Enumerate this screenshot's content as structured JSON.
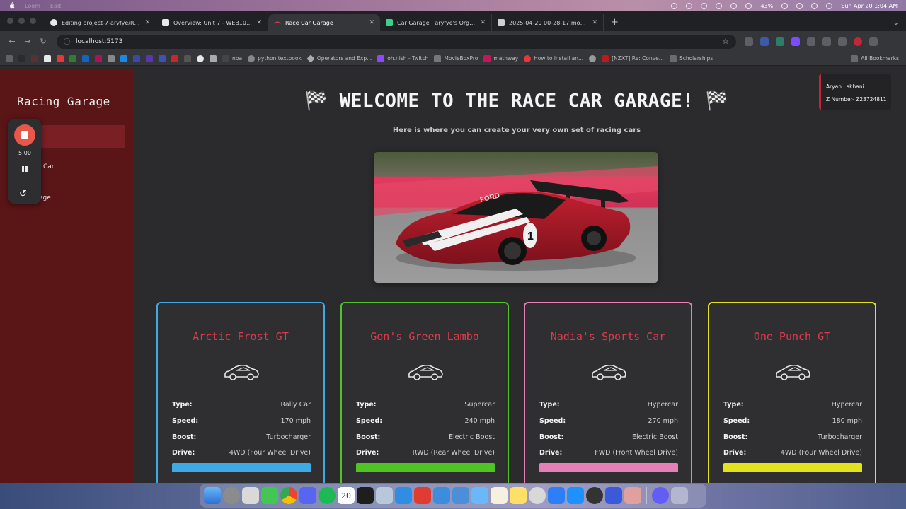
{
  "menubar": {
    "menus": [
      "Loom",
      "Edit"
    ],
    "battery": "43%",
    "datetime": "Sun Apr 20  1:04 AM"
  },
  "browser": {
    "tabs": [
      {
        "title": "Editing project-7-aryfye/README",
        "favicon_color": "#e8e8e8",
        "favicon": "github-icon"
      },
      {
        "title": "Overview: Unit 7 - WEB102 | C...",
        "favicon_color": "#e8e8e8",
        "favicon": "codepath-icon"
      },
      {
        "title": "Race Car Garage",
        "favicon_color": "#e23a4d",
        "favicon": "react-icon"
      },
      {
        "title": "Car Garage | aryfye's Org | Su...",
        "favicon_color": "#3ecf8e",
        "favicon": "supabase-icon"
      },
      {
        "title": "2025-04-20 00-28-17.mov - ...",
        "favicon_color": "#cfcfcf",
        "favicon": "drive-icon"
      }
    ],
    "active_tab_index": 2,
    "url": "localhost:5173",
    "bookmarks": [
      {
        "label": "nba",
        "color": "#444"
      },
      {
        "label": "python textbook",
        "color": "#888"
      },
      {
        "label": "Operators and Exp...",
        "color": "#aaa"
      },
      {
        "label": "oh.nish - Twitch",
        "color": "#9147ff"
      },
      {
        "label": "MovieBoxPro",
        "color": "#777"
      },
      {
        "label": "mathway",
        "color": "#c2185b"
      },
      {
        "label": "How to install an...",
        "color": "#e53935"
      },
      {
        "label": "[NZXT] Re: Conve...",
        "color": "#b71c1c"
      },
      {
        "label": "Scholarships",
        "color": "#6b6b6b"
      }
    ],
    "all_bookmarks": "All Bookmarks"
  },
  "sidebar": {
    "brand": "Racing Garage",
    "items": [
      "Car",
      "age"
    ]
  },
  "recorder": {
    "time": "5:00"
  },
  "user": {
    "name": "Aryan Lakhani",
    "znumber": "Z Number- Z23724811"
  },
  "hero": {
    "title": "🏁 WELCOME TO THE RACE CAR GARAGE! 🏁",
    "subtitle": "Here is where you can create your very own set of racing cars"
  },
  "cars": [
    {
      "name": "Arctic Frost GT",
      "color": "#3fa9e6",
      "type": "Rally Car",
      "speed": "170 mph",
      "boost": "Turbocharger",
      "drive": "4WD (Four Wheel Drive)"
    },
    {
      "name": "Gon's Green Lambo",
      "color": "#4fc424",
      "type": "Supercar",
      "speed": "240 mph",
      "boost": "Electric Boost",
      "drive": "RWD (Rear Wheel Drive)"
    },
    {
      "name": "Nadia's Sports Car",
      "color": "#e57fb8",
      "type": "Hypercar",
      "speed": "270 mph",
      "boost": "Electric Boost",
      "drive": "FWD (Front Wheel Drive)"
    },
    {
      "name": "One Punch GT",
      "color": "#e2e21e",
      "type": "Hypercar",
      "speed": "180 mph",
      "boost": "Turbocharger",
      "drive": "4WD (Four Wheel Drive)"
    }
  ],
  "labels": {
    "type": "Type:",
    "speed": "Speed:",
    "boost": "Boost:",
    "drive": "Drive:"
  },
  "dock": {
    "date_icon_text": "20",
    "apps": [
      "finder-icon",
      "launchpad-icon",
      "screenshot-icon",
      "messages-icon",
      "chrome-icon",
      "discord-icon",
      "spotify-icon",
      "calendar-icon",
      "terminal-icon",
      "preview-icon",
      "vscode-icon",
      "photo-booth-icon",
      "xcode-icon",
      "pycharm-icon",
      "finder2-icon",
      "notes-icon",
      "stickies-icon",
      "chatgpt-icon",
      "freeform-icon",
      "pages-icon",
      "clock-icon",
      "keyboard-icon",
      "launchpad2-icon",
      "loom-icon",
      "trash-icon"
    ]
  }
}
